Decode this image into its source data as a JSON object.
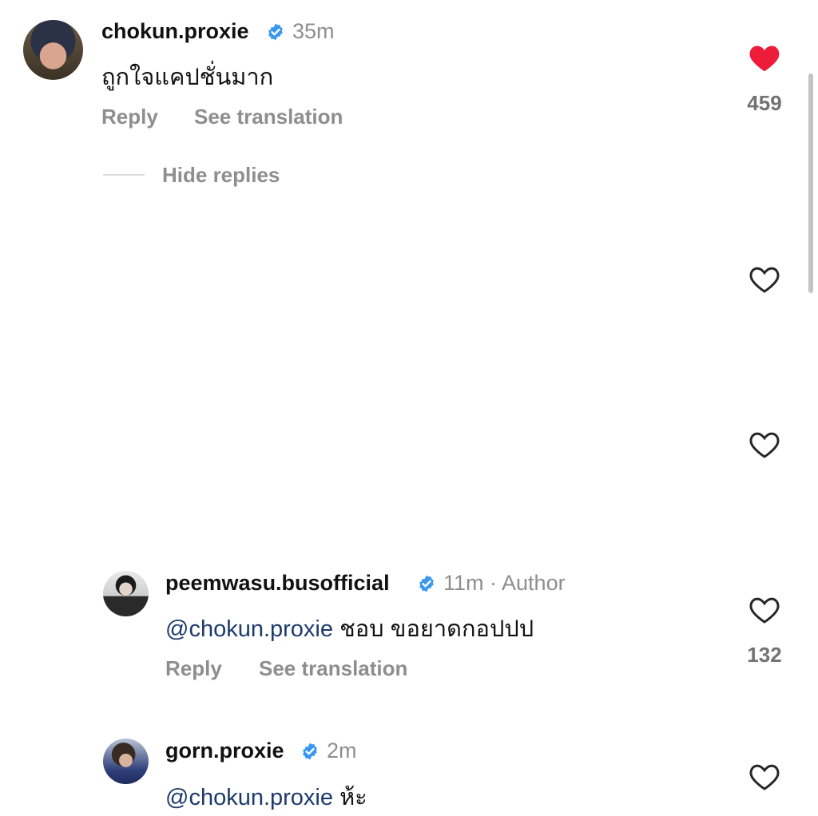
{
  "comments": [
    {
      "username": "chokun.proxie",
      "time": "35m",
      "text": "ถูกใจแคปชั่นมาก",
      "reply_label": "Reply",
      "translate_label": "See translation",
      "like_count": "459",
      "liked": true
    },
    {
      "username": "peemwasu.busofficial",
      "time": "11m · Author",
      "mention": "@chokun.proxie",
      "text": "ชอบ ขอยาดกอปปป",
      "reply_label": "Reply",
      "translate_label": "See translation",
      "like_count": "132",
      "liked": false
    },
    {
      "username": "gorn.proxie",
      "time": "2m",
      "mention": "@chokun.proxie",
      "text": "ห้ะ",
      "liked": false
    }
  ],
  "hide_replies_label": "Hide replies",
  "colors": {
    "liked_heart": "#ed1c3a",
    "verified_badge": "#3897f0",
    "mention": "#1c3a6b",
    "secondary_text": "#8e8e8e"
  },
  "icons": {
    "like": "heart-icon",
    "verified": "verified-badge-icon"
  }
}
